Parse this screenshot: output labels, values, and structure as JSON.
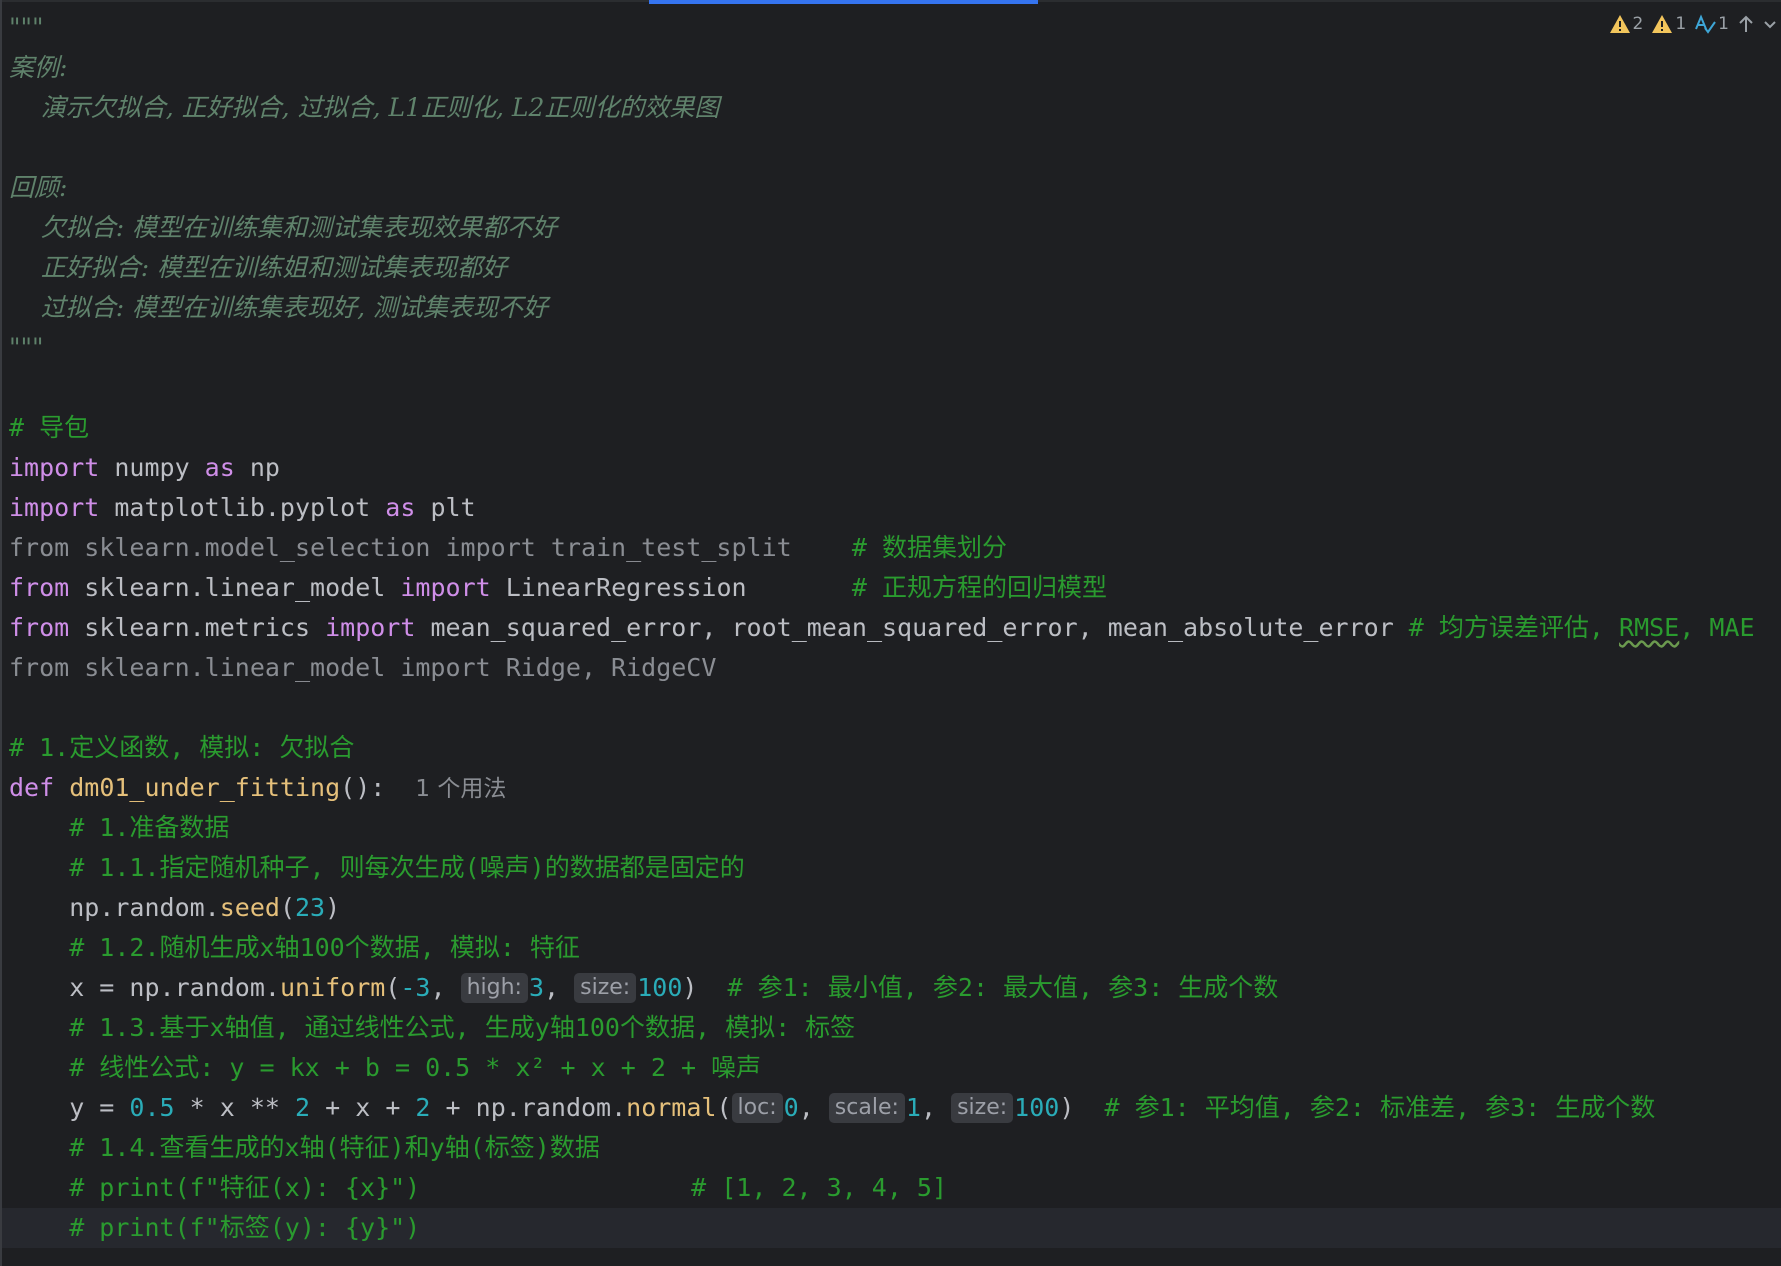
{
  "inspections": {
    "warnings_a": "2",
    "warnings_b": "1",
    "typos": "1"
  },
  "code": {
    "l1": "\"\"\"",
    "l2": "案例:",
    "l3": "    演示欠拟合, 正好拟合, 过拟合, L1正则化, L2正则化的效果图",
    "l5": "回顾:",
    "l6": "    欠拟合: 模型在训练集和测试集表现效果都不好",
    "l7": "    正好拟合: 模型在训练姐和测试集表现都好",
    "l8": "    过拟合: 模型在训练集表现好, 测试集表现不好",
    "l9": "\"\"\"",
    "l11": "# 导包",
    "l12": {
      "kw1": "import",
      "t1": " numpy ",
      "kw2": "as",
      "t2": " np"
    },
    "l13": {
      "kw1": "import",
      "t1": " matplotlib.pyplot ",
      "kw2": "as",
      "t2": " plt"
    },
    "l14": {
      "code": "from sklearn.model_selection import train_test_split",
      "pad": "    ",
      "cm": "# 数据集划分"
    },
    "l15": {
      "kw1": "from",
      "t1": " sklearn.linear_model ",
      "kw2": "import",
      "t2": " LinearRegression",
      "pad": "       ",
      "cm": "# 正规方程的回归模型"
    },
    "l16": {
      "kw1": "from",
      "t1": " sklearn.metrics ",
      "kw2": "import",
      "t2": " mean_squared_error, root_mean_squared_error, mean_absolute_error ",
      "cm_a": "# 均方误差评估, ",
      "cm_b": "RMSE",
      "cm_c": ", MAE"
    },
    "l17": {
      "code": "from sklearn.linear_model import Ridge, RidgeCV"
    },
    "l19": "# 1.定义函数, 模拟: 欠拟合",
    "l20": {
      "kw": "def",
      "sp": " ",
      "fn": "dm01_under_fitting",
      "t": "():",
      "usages": "1 个用法"
    },
    "l21": "    # 1.准备数据",
    "l22": "    # 1.1.指定随机种子, 则每次生成(噪声)的数据都是固定的",
    "l23": {
      "t1": "    np.random.",
      "fn": "seed",
      "t2": "(",
      "n": "23",
      "t3": ")"
    },
    "l24": "    # 1.2.随机生成x轴100个数据, 模拟: 特征",
    "l25": {
      "t1": "    x = np.random.",
      "fn": "uniform",
      "t2": "(",
      "n1": "-3",
      "t3": ", ",
      "h1": "high:",
      "n2": "3",
      "t4": ", ",
      "h2": "size:",
      "n3": "100",
      "t5": ")  ",
      "cm": "# 参1: 最小值, 参2: 最大值, 参3: 生成个数"
    },
    "l26": "    # 1.3.基于x轴值, 通过线性公式, 生成y轴100个数据, 模拟: 标签",
    "l27": "    # 线性公式: y = kx + b = 0.5 * x² + x + 2 + 噪声",
    "l28": {
      "t1": "    y = ",
      "n1": "0.5",
      "t2": " * x ** ",
      "n2": "2",
      "t3": " + x + ",
      "n3": "2",
      "t4": " + np.random.",
      "fn": "normal",
      "t5": "(",
      "h1": "loc:",
      "n4": "0",
      "t6": ", ",
      "h2": "scale:",
      "n5": "1",
      "t7": ", ",
      "h3": "size:",
      "n6": "100",
      "t8": ")  ",
      "cm": "# 参1: 平均值, 参2: 标准差, 参3: 生成个数"
    },
    "l29": "    # 1.4.查看生成的x轴(特征)和y轴(标签)数据",
    "l30": "    # print(f\"特征(x): {x}\")                  # [1, 2, 3, 4, 5]",
    "l31": "    # print(f\"标签(y): {y}\")"
  },
  "colors": {
    "background": "#1e1f22",
    "keyword": "#cf8ee8",
    "comment": "#2a9b2f",
    "docstring": "#5f826b",
    "function": "#e5c07b",
    "number": "#2aacb8",
    "warning": "#f2c55c"
  },
  "icons": [
    "warning-icon",
    "typo-icon",
    "arrow-up-icon",
    "chevron-down-icon"
  ]
}
